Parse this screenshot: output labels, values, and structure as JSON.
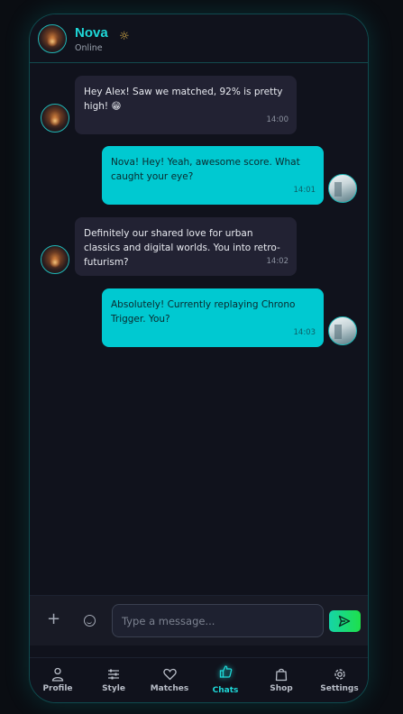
{
  "header": {
    "name": "Nova",
    "status": "Online",
    "mode_icon": "sun-icon"
  },
  "messages": [
    {
      "from": "Nova",
      "text": "Hey Alex! Saw we matched, 92% is pretty high! 😁",
      "time": "14:00"
    },
    {
      "from": "Alex",
      "text": "Nova! Hey! Yeah, awesome score. What caught your eye?",
      "time": "14:01"
    },
    {
      "from": "Nova",
      "text": "Definitely our shared love for urban classics and digital worlds. You into retro-futurism?",
      "time": "14:02"
    },
    {
      "from": "Alex",
      "text": "Absolutely! Currently replaying Chrono Trigger. You?",
      "time": "14:03"
    }
  ],
  "composer": {
    "placeholder": "Type a message...",
    "value": "",
    "add_icon": "plus-icon",
    "emoji_icon": "smiley-icon",
    "send_icon": "send-icon"
  },
  "nav": {
    "items": [
      {
        "label": "Profile",
        "icon": "person-icon"
      },
      {
        "label": "Style",
        "icon": "sliders-icon"
      },
      {
        "label": "Matches",
        "icon": "heart-icon"
      },
      {
        "label": "Chats",
        "icon": "thumbs-up-icon",
        "active": true
      },
      {
        "label": "Shop",
        "icon": "shopping-bag-icon"
      },
      {
        "label": "Settings",
        "icon": "gear-icon"
      }
    ]
  },
  "colors": {
    "accent": "#1ed8d8",
    "outgoing_bubble": "#00c9d1",
    "incoming_bubble": "#222233",
    "background": "#10121c"
  }
}
